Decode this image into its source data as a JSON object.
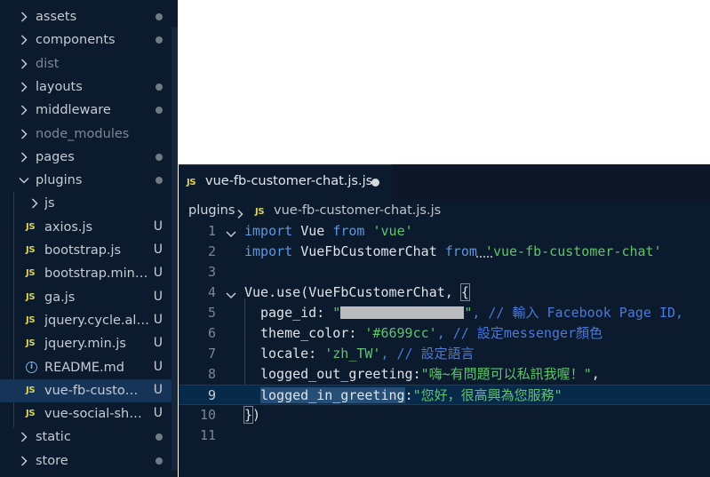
{
  "explorer": {
    "items": [
      {
        "label": "assets",
        "kind": "folder",
        "expanded": false,
        "status": "dot"
      },
      {
        "label": "components",
        "kind": "folder",
        "expanded": false,
        "status": "dot"
      },
      {
        "label": "dist",
        "kind": "folder",
        "expanded": false,
        "status": "",
        "dim": true
      },
      {
        "label": "layouts",
        "kind": "folder",
        "expanded": false,
        "status": "dot"
      },
      {
        "label": "middleware",
        "kind": "folder",
        "expanded": false,
        "status": "dot"
      },
      {
        "label": "node_modules",
        "kind": "folder",
        "expanded": false,
        "status": "",
        "dim": true
      },
      {
        "label": "pages",
        "kind": "folder",
        "expanded": false,
        "status": "dot"
      },
      {
        "label": "plugins",
        "kind": "folder",
        "expanded": true,
        "status": "dot"
      },
      {
        "label": "js",
        "kind": "subfolder",
        "expanded": false,
        "status": ""
      },
      {
        "label": "axios.js",
        "kind": "js",
        "status": "U"
      },
      {
        "label": "bootstrap.js",
        "kind": "js",
        "status": "U"
      },
      {
        "label": "bootstrap.min.js",
        "kind": "js",
        "status": "U"
      },
      {
        "label": "ga.js",
        "kind": "js",
        "status": "U"
      },
      {
        "label": "jquery.cycle.all.js",
        "kind": "js",
        "status": "U"
      },
      {
        "label": "jquery.min.js",
        "kind": "js",
        "status": "U"
      },
      {
        "label": "README.md",
        "kind": "info",
        "status": "U"
      },
      {
        "label": "vue-fb-custom...",
        "kind": "js",
        "status": "U",
        "selected": true
      },
      {
        "label": "vue-social-shar...",
        "kind": "js",
        "status": "U"
      },
      {
        "label": "static",
        "kind": "folder",
        "expanded": false,
        "status": "dot"
      },
      {
        "label": "store",
        "kind": "folder",
        "expanded": false,
        "status": "dot"
      }
    ]
  },
  "editor": {
    "tab": {
      "icon": "JS",
      "label": "vue-fb-customer-chat.js.js",
      "dirty": true
    },
    "breadcrumb": {
      "folder": "plugins",
      "icon": "JS",
      "file": "vue-fb-customer-chat.js.js"
    },
    "lines": [
      {
        "no": "1"
      },
      {
        "no": "2"
      },
      {
        "no": "3"
      },
      {
        "no": "4"
      },
      {
        "no": "5"
      },
      {
        "no": "6"
      },
      {
        "no": "7"
      },
      {
        "no": "8"
      },
      {
        "no": "9"
      },
      {
        "no": "10"
      },
      {
        "no": "11"
      }
    ],
    "code": {
      "l1_import": "import",
      "l1_name": " Vue ",
      "l1_from": "from",
      "l1_src": " 'vue'",
      "l2_import": "import",
      "l2_name": " VueFbCustomerChat ",
      "l2_from": "from",
      "l2_src_a": " '",
      "l2_src_b": "vue-fb-customer-chat'",
      "l4_obj": "Vue",
      "l4_use": ".use(VueFbCustomerChat, ",
      "l4_brace": "{",
      "l5_key": "page_id: ",
      "l5_q1": "\"",
      "l5_q2": "\"",
      "l5_comment": ", // 輸入 Facebook Page ID,",
      "l6_key": "theme_color: ",
      "l6_val": "'#6699cc'",
      "l6_comment": ", // 設定messenger顏色",
      "l7_key": "locale: ",
      "l7_val": "'zh_TW'",
      "l7_comment": ", // 設定語言",
      "l8_key": "logged_out_greeting:",
      "l8_val": "\"嗨~有問題可以私訊我喔！\"",
      "l8_end": ",",
      "l9_key": "logged_in_greeting",
      "l9_colon": ":",
      "l9_val": "\"您好，很高興為您服務\"",
      "l10_brace": "}",
      "l10_paren": ")"
    }
  }
}
